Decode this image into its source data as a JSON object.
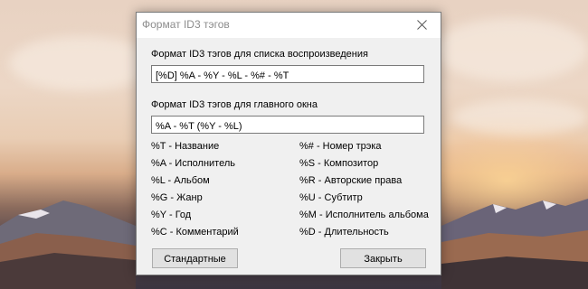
{
  "dialog": {
    "title": "Формат ID3 тэгов",
    "playlist_label": "Формат ID3 тэгов для списка воспроизведения",
    "playlist_value": "[%D] %A - %Y - %L - %# - %T",
    "main_label": "Формат ID3 тэгов для главного окна",
    "main_value": "%A - %T (%Y - %L)",
    "legend_left": [
      "%T - Название",
      "%A - Исполнитель",
      "%L - Альбом",
      "%G - Жанр",
      "%Y - Год",
      "%C - Комментарий"
    ],
    "legend_right": [
      "%# - Номер трэка",
      "%S - Композитор",
      "%R - Авторские права",
      "%U - Субтитр",
      "%M - Исполнитель альбома",
      "%D - Длительность"
    ],
    "defaults_button": "Стандартные",
    "close_button": "Закрыть"
  }
}
